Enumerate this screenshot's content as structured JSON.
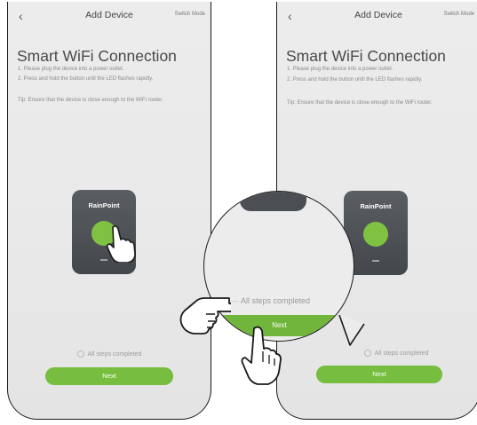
{
  "screens": [
    {
      "nav": {
        "back_icon": "‹",
        "title": "Add Device",
        "switch_mode": "Switch Mode"
      },
      "heading": "Smart WiFi Connection",
      "steps": [
        "1. Please plug the device into a power outlet.",
        "2. Press and hold the button until the LED flashes rapidly.",
        "Tip: Ensure that the device is close enough to the WiFi router."
      ],
      "device_brand": "RainPoint",
      "confirm_label": "All steps completed",
      "next_label": "Next"
    },
    {
      "nav": {
        "back_icon": "‹",
        "title": "Add Device",
        "switch_mode": "Switch Mode"
      },
      "heading": "Smart WiFi Connection",
      "steps": [
        "1. Please plug the device into a power outlet.",
        "2. Press and hold the button until the LED flashes rapidly.",
        "Tip: Ensure that the device is close enough to the WiFi router."
      ],
      "device_brand": "RainPoint",
      "confirm_label": "All steps completed",
      "next_label": "Next"
    }
  ],
  "zoom_callout": {
    "confirm_label": "All steps completed",
    "next_label": "Next"
  },
  "colors": {
    "accent_green": "#77bd3f",
    "device_gray": "#4b4f53",
    "screen_bg": "#ececec"
  }
}
